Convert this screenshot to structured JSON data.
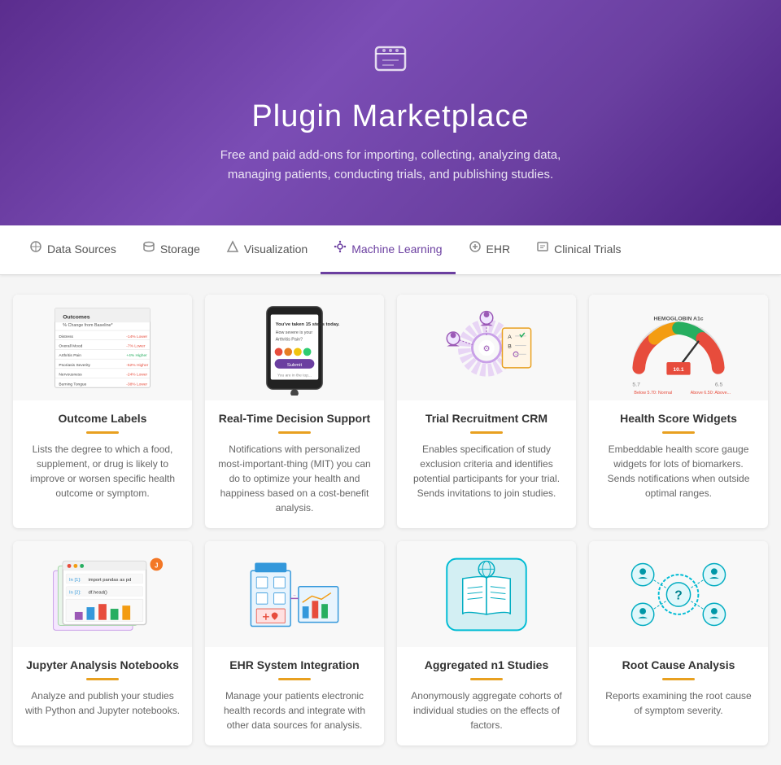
{
  "header": {
    "icon": "⬡",
    "title": "Plugin Marketplace",
    "subtitle": "Free and paid add-ons for importing, collecting, analyzing data, managing patients, conducting trials, and publishing studies."
  },
  "nav": {
    "items": [
      {
        "id": "data-sources",
        "label": "Data Sources",
        "icon": "⊕",
        "active": false
      },
      {
        "id": "storage",
        "label": "Storage",
        "icon": "◎",
        "active": false
      },
      {
        "id": "visualization",
        "label": "Visualization",
        "icon": "✾",
        "active": false
      },
      {
        "id": "machine-learning",
        "label": "Machine Learning",
        "icon": "⚙",
        "active": true
      },
      {
        "id": "ehr",
        "label": "EHR",
        "icon": "⊕",
        "active": false
      },
      {
        "id": "clinical-trials",
        "label": "Clinical Trials",
        "icon": "◎",
        "active": false
      }
    ]
  },
  "cards": [
    {
      "id": "outcome-labels",
      "title": "Outcome Labels",
      "description": "Lists the degree to which a food, supplement, or drug is likely to improve or worsen specific health outcome or symptom.",
      "type": "table"
    },
    {
      "id": "real-time-decision-support",
      "title": "Real-Time Decision Support",
      "description": "Notifications with personalized most-important-thing (MIT) you can do to optimize your health and happiness based on a cost-benefit analysis.",
      "type": "phone"
    },
    {
      "id": "trial-recruitment-crm",
      "title": "Trial Recruitment CRM",
      "description": "Enables specification of study exclusion criteria and identifies potential participants for your trial.  Sends invitations to join studies.",
      "type": "crm"
    },
    {
      "id": "health-score-widgets",
      "title": "Health Score Widgets",
      "description": "Embeddable health score gauge widgets for lots of biomarkers. Sends notifications when outside optimal ranges.",
      "type": "gauge"
    },
    {
      "id": "jupyter-analysis-notebooks",
      "title": "Jupyter Analysis Notebooks",
      "description": "Analyze and publish your studies with Python and Jupyter notebooks.",
      "type": "jupyter"
    },
    {
      "id": "ehr-system-integration",
      "title": "EHR System Integration",
      "description": "Manage your patients electronic health records and integrate with other data sources for analysis.",
      "type": "ehr"
    },
    {
      "id": "aggregated-n1-studies",
      "title": "Aggregated n1 Studies",
      "description": "Anonymously aggregate cohorts of individual studies on the effects of factors.",
      "type": "aggregated"
    },
    {
      "id": "root-cause-analysis",
      "title": "Root Cause Analysis",
      "description": "Reports examining the root cause of symptom severity.",
      "type": "rootcause"
    }
  ]
}
